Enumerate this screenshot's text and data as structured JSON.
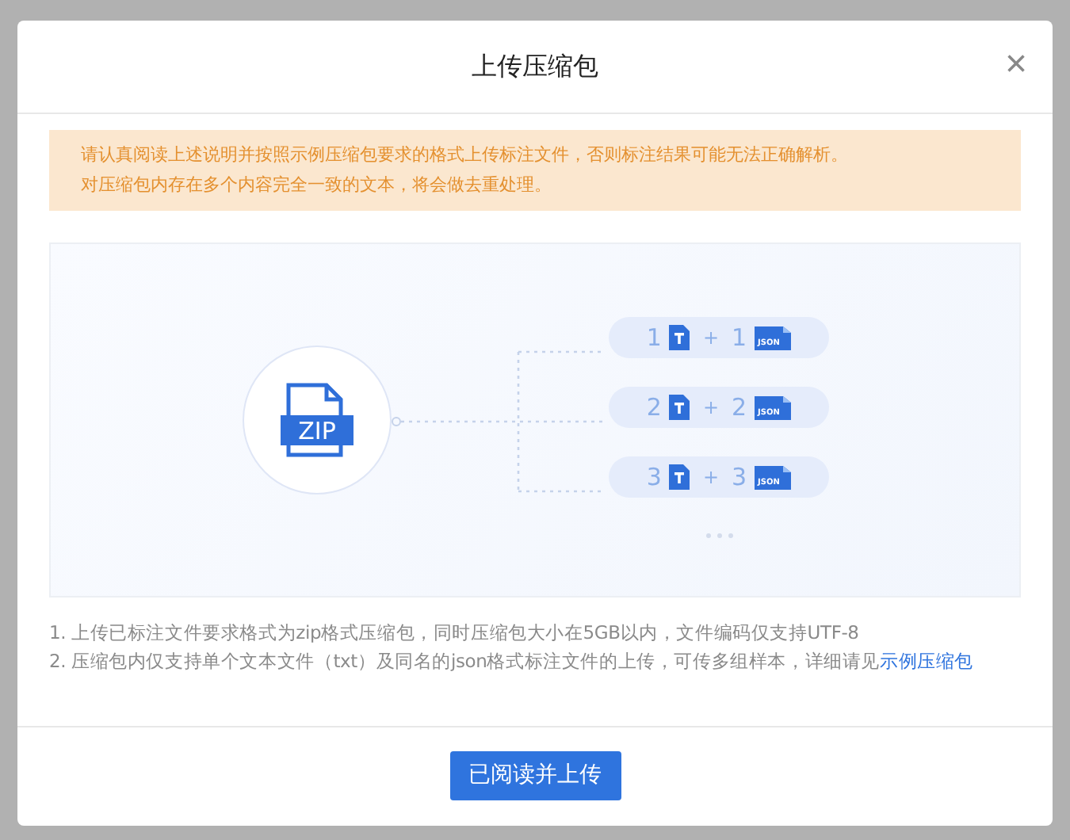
{
  "dialog": {
    "title": "上传压缩包",
    "close": "×"
  },
  "notice": [
    "请认真阅读上述说明并按照示例压缩包要求的格式上传标注文件，否则标注结果可能无法正确解析。",
    "对压缩包内存在多个内容完全一致的文本，将会做去重处理。"
  ],
  "illustration": {
    "archive_label": "ZIP",
    "pairs": [
      {
        "text_count": "1",
        "plus": "+",
        "json_count": "1",
        "json_label": "JSON"
      },
      {
        "text_count": "2",
        "plus": "+",
        "json_count": "2",
        "json_label": "JSON"
      },
      {
        "text_count": "3",
        "plus": "+",
        "json_count": "3",
        "json_label": "JSON"
      }
    ]
  },
  "rules": [
    {
      "text": "1. 上传已标注文件要求格式为zip格式压缩包，同时压缩包大小在5GB以内，文件编码仅支持UTF-8"
    },
    {
      "text": "2. 压缩包内仅支持单个文本文件（txt）及同名的json格式标注文件的上传，可传多组样本，详细请见",
      "link": "示例压缩包"
    }
  ],
  "primary_button": "已阅读并上传"
}
